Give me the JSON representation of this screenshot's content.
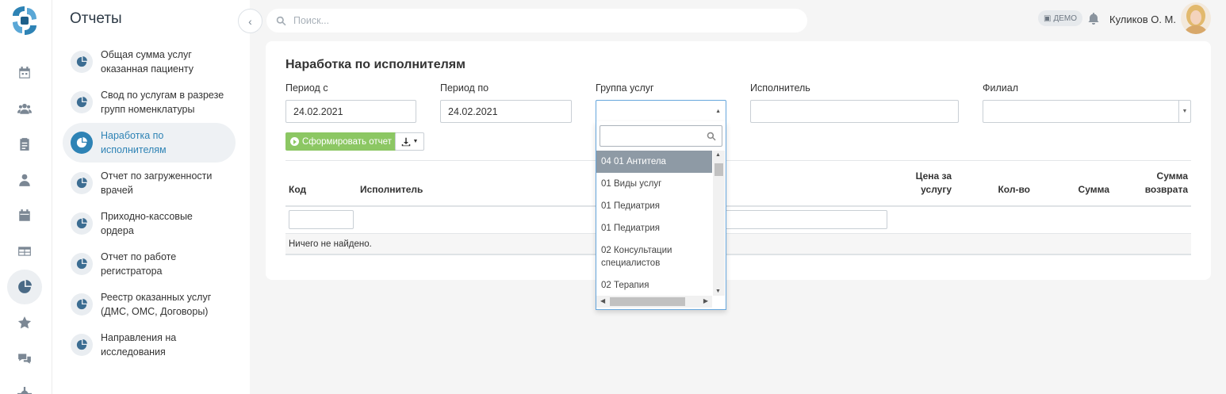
{
  "sidebar": {
    "title": "Отчеты",
    "items": [
      {
        "label": "Общая сумма услуг оказанная пациенту"
      },
      {
        "label": "Свод по услугам в разрезе групп номенклатуры"
      },
      {
        "label": "Наработка по исполнителям",
        "active": true
      },
      {
        "label": "Отчет по загруженности врачей"
      },
      {
        "label": "Приходно-кассовые ордера"
      },
      {
        "label": "Отчет по работе регистратора"
      },
      {
        "label": "Реестр оказанных услуг (ДМС, ОМС, Договоры)"
      },
      {
        "label": "Направления на исследования"
      }
    ]
  },
  "rail_icons": [
    "calendar-icon",
    "users-icon",
    "clipboard-icon",
    "doctor-icon",
    "schedule-icon",
    "table-icon",
    "reports-pie-icon",
    "star-icon",
    "chat-icon",
    "settings-icon"
  ],
  "topbar": {
    "search_placeholder": "Поиск...",
    "demo_badge": "ДЕМО",
    "user_name": "Куликов О. М."
  },
  "report": {
    "title": "Наработка по исполнителям",
    "period_from_label": "Период с",
    "period_from_value": "24.02.2021",
    "period_to_label": "Период по",
    "period_to_value": "24.02.2021",
    "service_group_label": "Группа услуг",
    "executor_label": "Исполнитель",
    "branch_label": "Филиал",
    "generate_button": "Сформировать отчет",
    "columns": {
      "code": "Код",
      "executor": "Исполнитель",
      "price_l1": "Цена за",
      "price_l2": "услугу",
      "qty": "Кол-во",
      "sum": "Сумма",
      "refund_l1": "Сумма",
      "refund_l2": "возврата"
    },
    "empty_text": "Ничего не найдено."
  },
  "dropdown": {
    "search_value": "",
    "options": [
      {
        "label": "04 01 Антитела",
        "highlighted": true
      },
      {
        "label": "01 Виды услуг"
      },
      {
        "label": "01 Педиатрия"
      },
      {
        "label": "01 Педиатрия"
      },
      {
        "label": "02 Консультации специалистов"
      },
      {
        "label": "02 Терапия"
      }
    ]
  },
  "colors": {
    "accent": "#2e83b5",
    "generate_green": "#8cc763",
    "highlight": "#8e9aa5"
  }
}
